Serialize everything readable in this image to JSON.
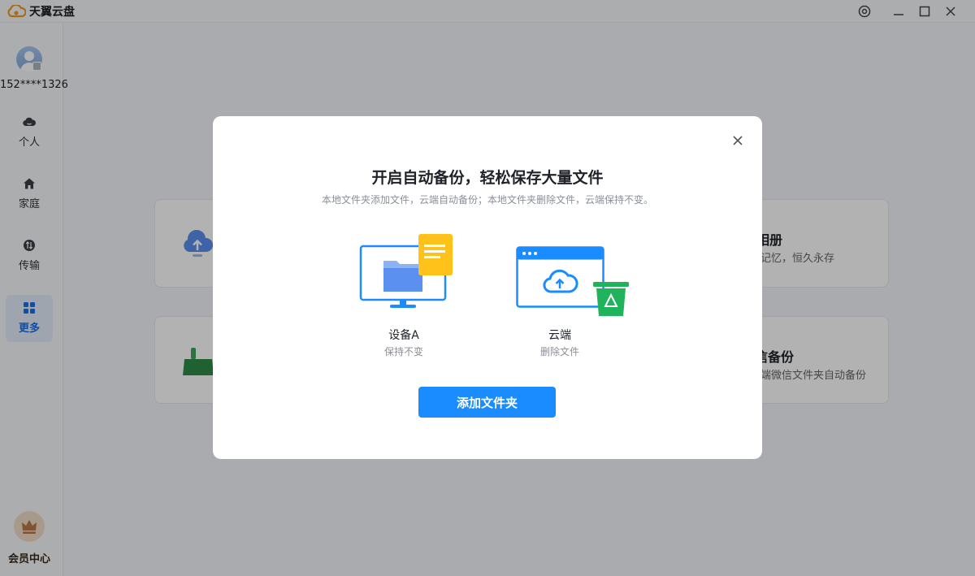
{
  "app": {
    "title": "天翼云盘"
  },
  "sidebar": {
    "phone": "152****1326",
    "items": [
      {
        "label": "个人",
        "icon": "cloud-icon"
      },
      {
        "label": "家庭",
        "icon": "home-icon"
      },
      {
        "label": "传输",
        "icon": "transfer-icon"
      },
      {
        "label": "更多",
        "icon": "grid-icon",
        "active": true
      }
    ],
    "vip_label": "会员中心"
  },
  "background_cards": [
    {
      "title": "相册",
      "desc": "记忆，恒久永存"
    },
    {
      "title": "信备份",
      "desc": "端微信文件夹自动备份"
    }
  ],
  "modal": {
    "title": "开启自动备份，轻松保存大量文件",
    "subtitle": "本地文件夹添加文件，云端自动备份；本地文件夹删除文件，云端保持不变。",
    "device": {
      "label": "设备A",
      "sub": "保持不变"
    },
    "cloud": {
      "label": "云端",
      "sub": "删除文件"
    },
    "button": "添加文件夹"
  },
  "colors": {
    "accent": "#1a8cff",
    "active_nav": "#1a6fe8",
    "folder_doc": "#ffc21a",
    "trash": "#1fb35c"
  }
}
